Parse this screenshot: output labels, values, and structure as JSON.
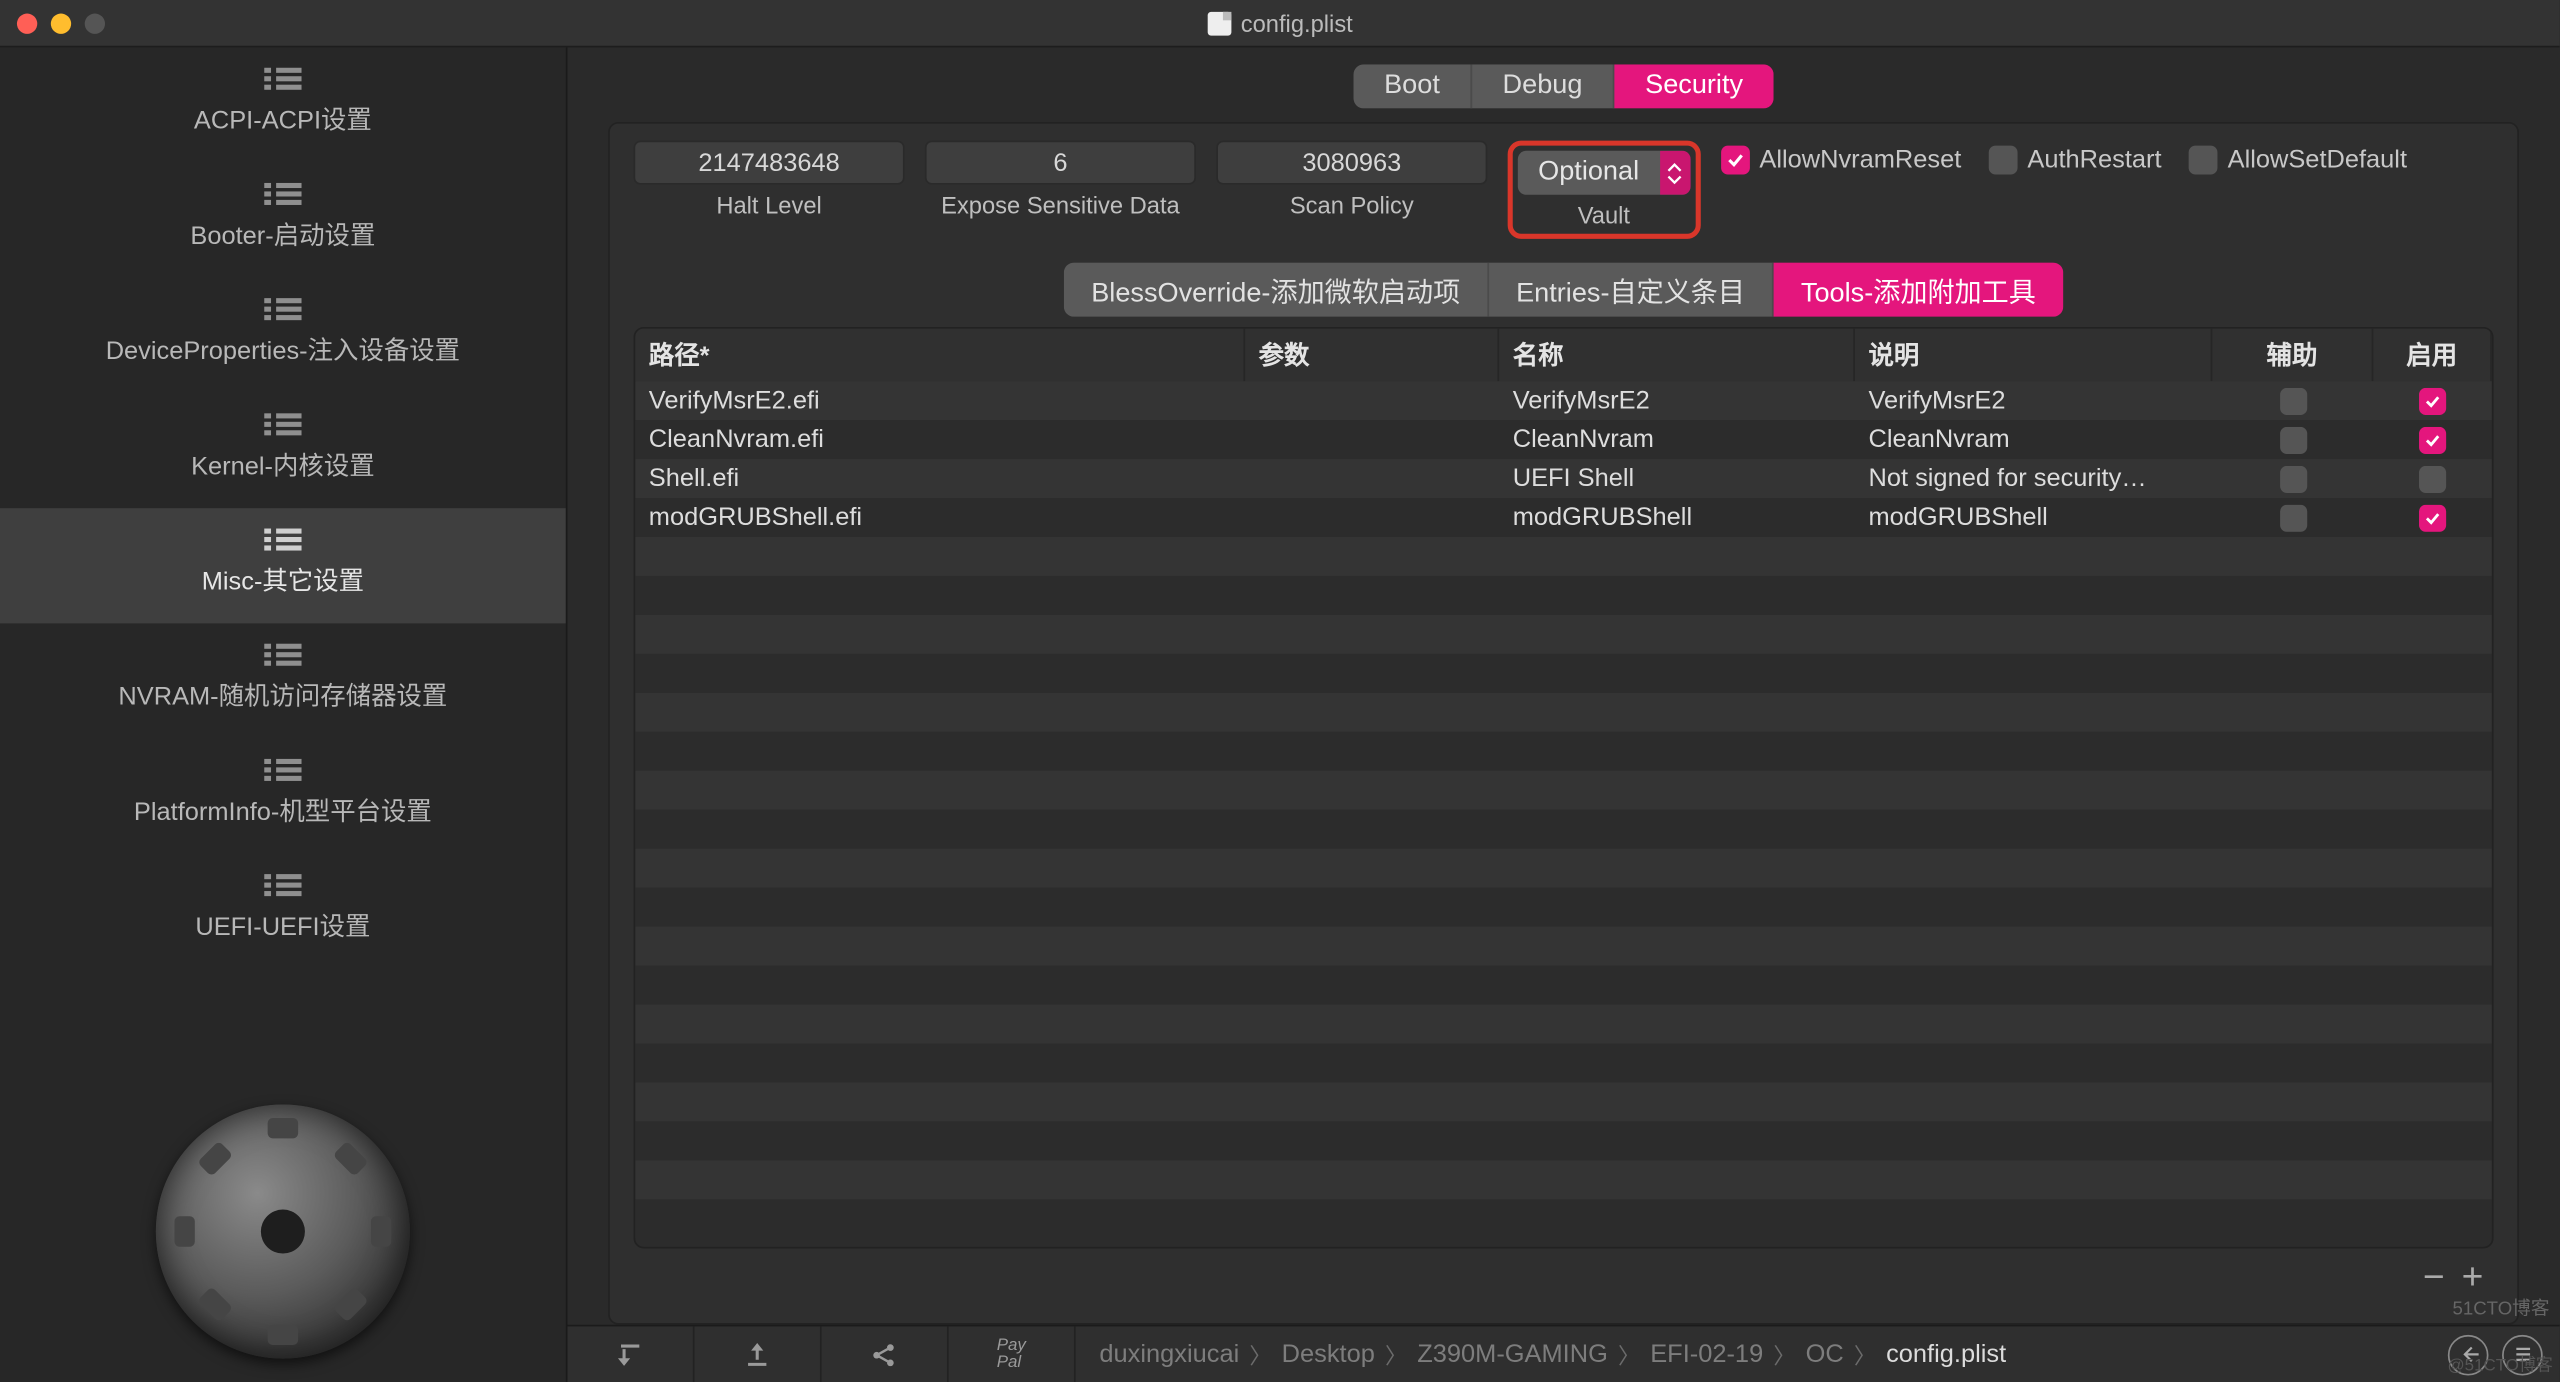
{
  "window": {
    "title": "config.plist"
  },
  "sidebar": {
    "items": [
      {
        "label": "ACPI-ACPI设置"
      },
      {
        "label": "Booter-启动设置"
      },
      {
        "label": "DeviceProperties-注入设备设置"
      },
      {
        "label": "Kernel-内核设置"
      },
      {
        "label": "Misc-其它设置"
      },
      {
        "label": "NVRAM-随机访问存储器设置"
      },
      {
        "label": "PlatformInfo-机型平台设置"
      },
      {
        "label": "UEFI-UEFI设置"
      }
    ],
    "active_index": 4
  },
  "tabs": {
    "items": [
      "Boot",
      "Debug",
      "Security"
    ],
    "active_index": 2
  },
  "config_fields": {
    "halt_level": {
      "value": "2147483648",
      "label": "Halt Level"
    },
    "expose_sensitive_data": {
      "value": "6",
      "label": "Expose Sensitive Data"
    },
    "scan_policy": {
      "value": "3080963",
      "label": "Scan Policy"
    },
    "vault": {
      "value": "Optional",
      "label": "Vault"
    }
  },
  "checkboxes": {
    "allow_nvram_reset": {
      "label": "AllowNvramReset",
      "checked": true
    },
    "auth_restart": {
      "label": "AuthRestart",
      "checked": false
    },
    "allow_set_default": {
      "label": "AllowSetDefault",
      "checked": false
    }
  },
  "subtabs": {
    "items": [
      "BlessOverride-添加微软启动项",
      "Entries-自定义条目",
      "Tools-添加附加工具"
    ],
    "active_index": 2
  },
  "table": {
    "headers": {
      "path": "路径*",
      "args": "参数",
      "name": "名称",
      "desc": "说明",
      "aux": "辅助",
      "enable": "启用"
    },
    "rows": [
      {
        "path": "VerifyMsrE2.efi",
        "args": "",
        "name": "VerifyMsrE2",
        "desc": "VerifyMsrE2",
        "aux": false,
        "enable": true
      },
      {
        "path": "CleanNvram.efi",
        "args": "",
        "name": "CleanNvram",
        "desc": "CleanNvram",
        "aux": false,
        "enable": true
      },
      {
        "path": "Shell.efi",
        "args": "",
        "name": "UEFI Shell",
        "desc": "Not signed for security…",
        "aux": false,
        "enable": false
      },
      {
        "path": "modGRUBShell.efi",
        "args": "",
        "name": "modGRUBShell",
        "desc": "modGRUBShell",
        "aux": false,
        "enable": true
      }
    ]
  },
  "table_actions": {
    "remove": "−",
    "add": "+"
  },
  "breadcrumb": [
    "duxingxiucai",
    "Desktop",
    "Z390M-GAMING",
    "EFI-02-19",
    "OC",
    "config.plist"
  ],
  "bottom_icons": {
    "paypal": "Pay\nPal"
  },
  "watermark": "51CTO博客",
  "watermark_tag": "@51CTO博客"
}
